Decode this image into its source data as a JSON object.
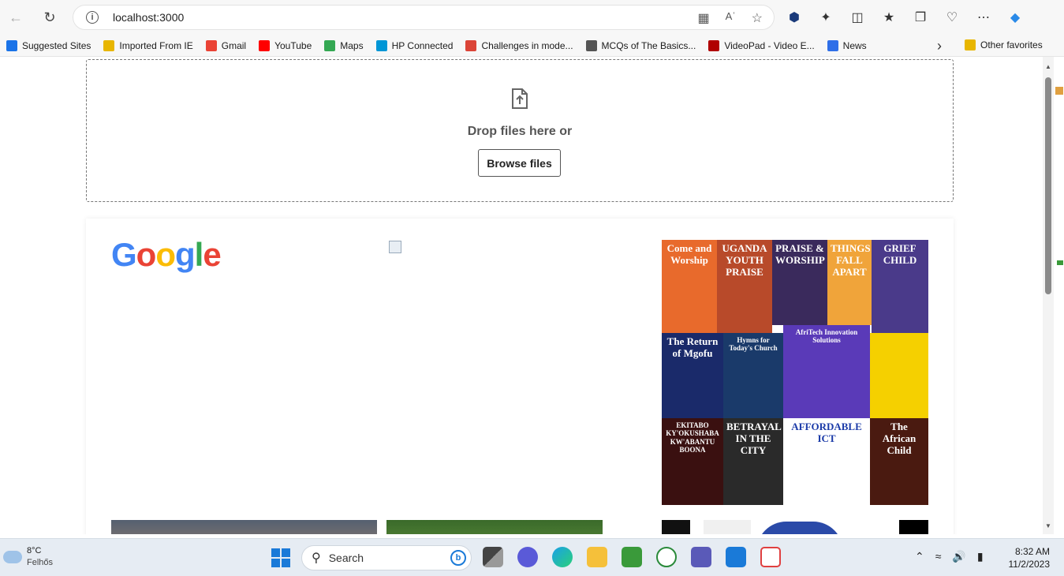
{
  "browser": {
    "url": "localhost:3000"
  },
  "favorites": [
    {
      "label": "Suggested Sites",
      "icon": "search-icon",
      "color": "#1a73e8"
    },
    {
      "label": "Imported From IE",
      "icon": "folder-icon",
      "color": "#e8b600"
    },
    {
      "label": "Gmail",
      "icon": "gmail-icon",
      "color": "#ea4335"
    },
    {
      "label": "YouTube",
      "icon": "youtube-icon",
      "color": "#ff0000"
    },
    {
      "label": "Maps",
      "icon": "maps-icon",
      "color": "#34a853"
    },
    {
      "label": "HP Connected",
      "icon": "hp-icon",
      "color": "#0096d6"
    },
    {
      "label": "Challenges in mode...",
      "icon": "challenges-icon",
      "color": "#db4437"
    },
    {
      "label": "MCQs of The Basics...",
      "icon": "document-icon",
      "color": "#555555"
    },
    {
      "label": "VideoPad - Video E...",
      "icon": "videopad-icon",
      "color": "#b00000"
    },
    {
      "label": "News",
      "icon": "news-icon",
      "color": "#2f6fe8"
    }
  ],
  "favorites_other": "Other favorites",
  "dropzone": {
    "text": "Drop files here or",
    "button": "Browse files"
  },
  "logo_text": "Google",
  "books": [
    {
      "title": "Come and Worship",
      "color": "#e86a2c"
    },
    {
      "title": "UGANDA YOUTH PRAISE",
      "color": "#b84a2a"
    },
    {
      "title": "PRAISE & WORSHIP",
      "color": "#3a2a5c"
    },
    {
      "title": "THINGS FALL APART",
      "color": "#f0a43a"
    },
    {
      "title": "GRIEF CHILD",
      "color": "#4a3a8a"
    },
    {
      "title": "The Return of Mgofu",
      "color": "#1a2a6a"
    },
    {
      "title": "Hymns for Today's Church",
      "color": "#1a3a6a"
    },
    {
      "title": "AfriTech Innovation Solutions",
      "color": "#5a3ab8"
    },
    {
      "title": "",
      "color": "#f5d000"
    },
    {
      "title": "EKITABO KY'OKUSHABA KW'ABANTU BOONA",
      "color": "#3a1010"
    },
    {
      "title": "BETRAYAL IN THE CITY",
      "color": "#2a2a2a"
    },
    {
      "title": "AFFORDABLE ICT",
      "color": "#ffffff"
    },
    {
      "title": "The African Child",
      "color": "#4a1a10"
    }
  ],
  "taskbar": {
    "temperature": "8°C",
    "weather_place": "Felhős",
    "search_placeholder": "Search",
    "time": "8:32 AM",
    "date": "11/2/2023"
  }
}
